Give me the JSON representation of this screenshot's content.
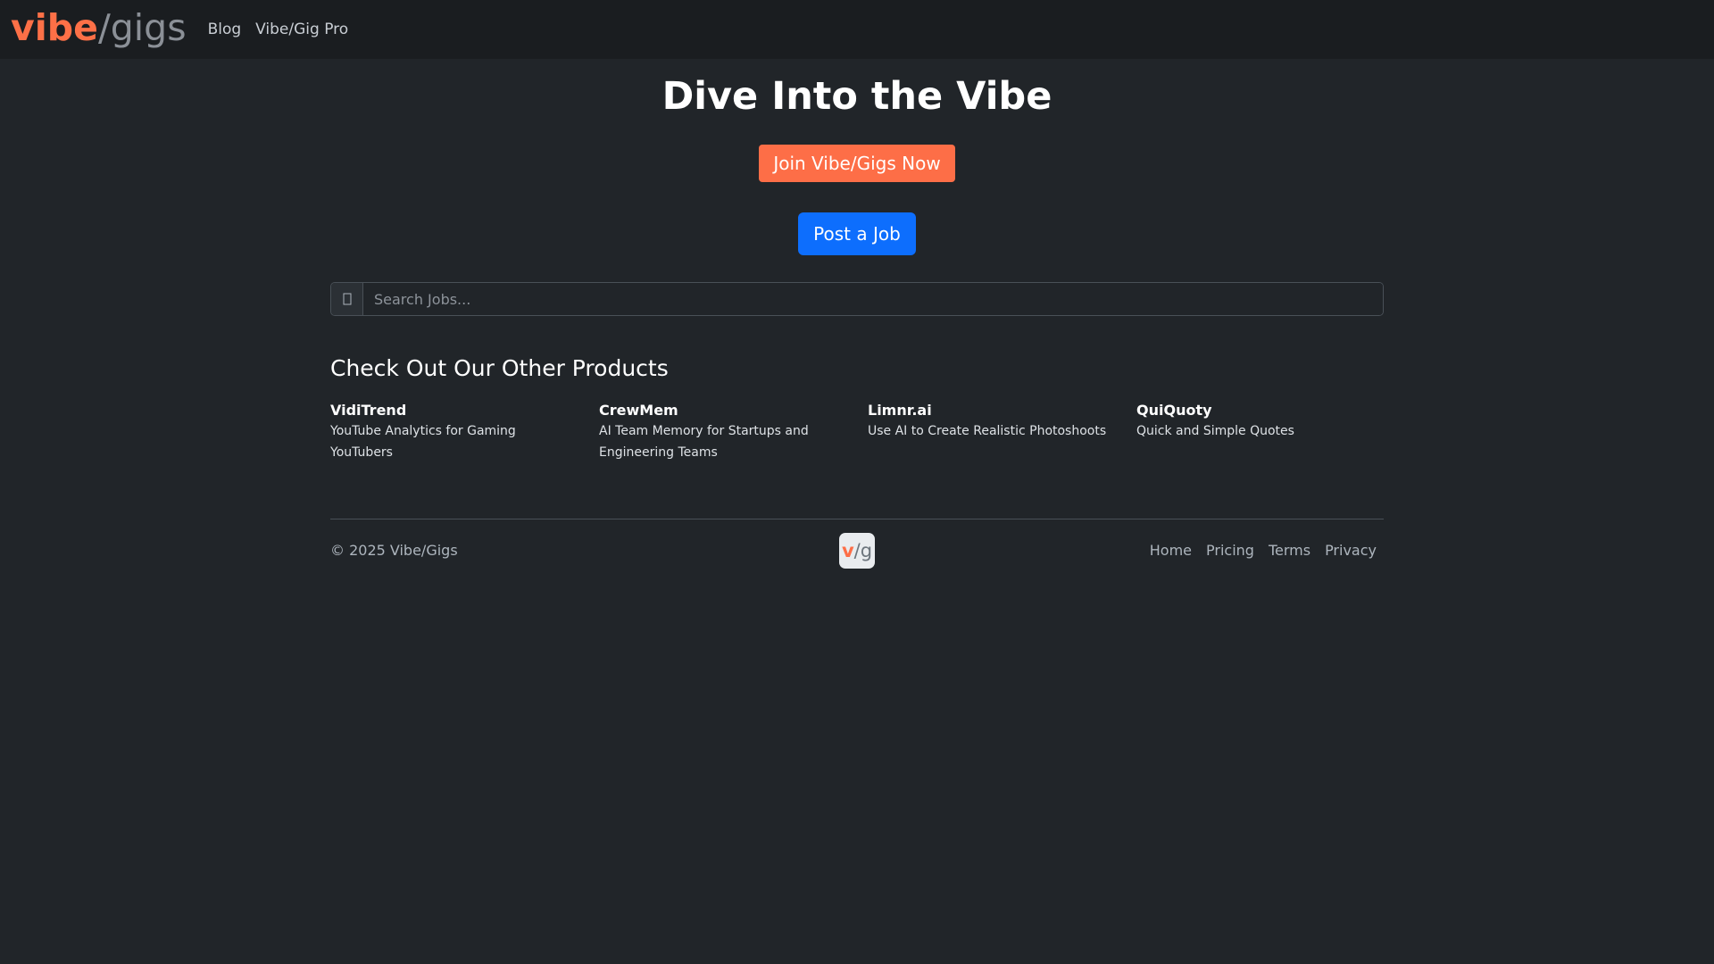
{
  "navbar": {
    "brand": {
      "part1": "vibe",
      "slash": "/",
      "part2": "gigs"
    },
    "links": [
      {
        "label": "Blog"
      },
      {
        "label": "Vibe/Gig Pro"
      }
    ]
  },
  "hero": {
    "title": "Dive Into the Vibe",
    "join_label": "Join Vibe/Gigs Now",
    "post_label": "Post a Job"
  },
  "search": {
    "icon": "search-icon",
    "placeholder": "Search Jobs...",
    "value": ""
  },
  "products": {
    "heading": "Check Out Our Other Products",
    "items": [
      {
        "name": "VidiTrend",
        "description": "YouTube Analytics for Gaming YouTubers"
      },
      {
        "name": "CrewMem",
        "description": "AI Team Memory for Startups and Engineering Teams"
      },
      {
        "name": "Limnr.ai",
        "description": "Use AI to Create Realistic Photoshoots"
      },
      {
        "name": "QuiQuoty",
        "description": "Quick and Simple Quotes"
      }
    ]
  },
  "footer": {
    "copyright": "© 2025 Vibe/Gigs",
    "logo": {
      "v": "v",
      "slash": "/",
      "g": "g"
    },
    "links": [
      {
        "label": "Home"
      },
      {
        "label": "Pricing"
      },
      {
        "label": "Terms"
      },
      {
        "label": "Privacy"
      }
    ]
  },
  "colors": {
    "background": "#212529",
    "navbar": "#1a1d20",
    "accent_orange": "#fd6e47",
    "primary_blue": "#0d6efd"
  }
}
